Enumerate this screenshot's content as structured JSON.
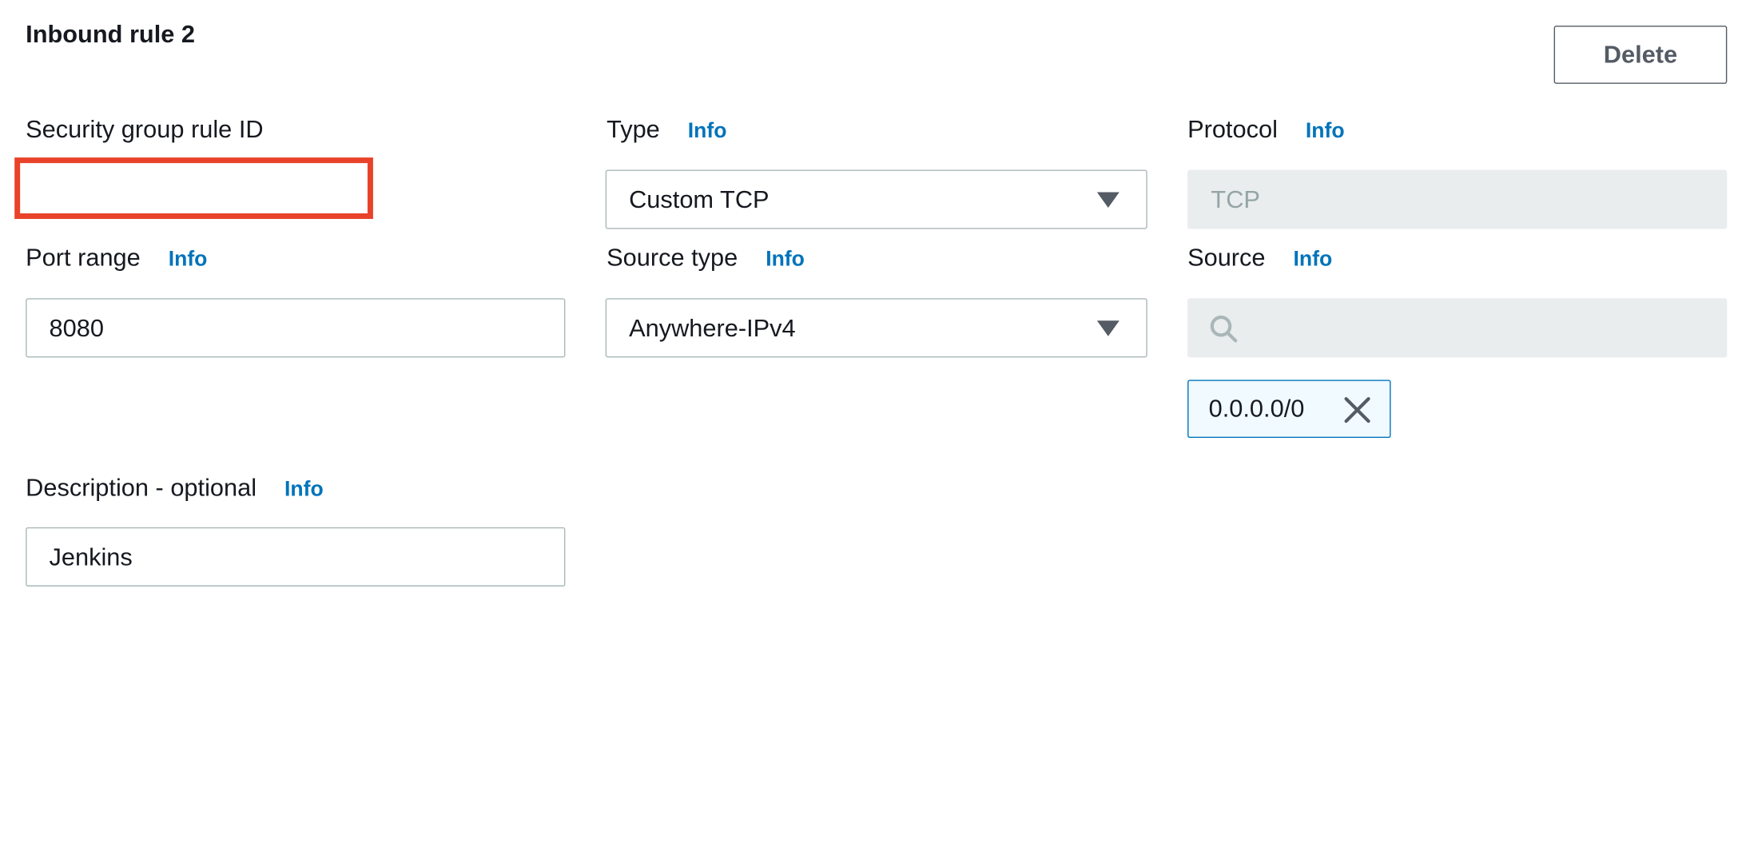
{
  "rule": {
    "title": "Inbound rule 2",
    "delete_label": "Delete"
  },
  "info_label": "Info",
  "fields": {
    "security_group_rule_id": {
      "label": "Security group rule ID",
      "value": ""
    },
    "type": {
      "label": "Type",
      "value": "Custom TCP"
    },
    "protocol": {
      "label": "Protocol",
      "value": "TCP"
    },
    "port_range": {
      "label": "Port range",
      "value": "8080"
    },
    "source_type": {
      "label": "Source type",
      "value": "Anywhere-IPv4"
    },
    "source": {
      "label": "Source",
      "search_value": "",
      "tokens": [
        "0.0.0.0/0"
      ]
    },
    "description": {
      "label": "Description - optional",
      "value": "Jenkins"
    }
  },
  "icons": {
    "select_arrow": "caret-down-icon",
    "search": "search-icon",
    "token_remove": "close-icon"
  },
  "colors": {
    "info_link": "#0073bb",
    "highlight": "#e8432a",
    "token_border": "#0073bb",
    "token_bg": "#f1faff",
    "disabled_bg": "#eaeded"
  }
}
